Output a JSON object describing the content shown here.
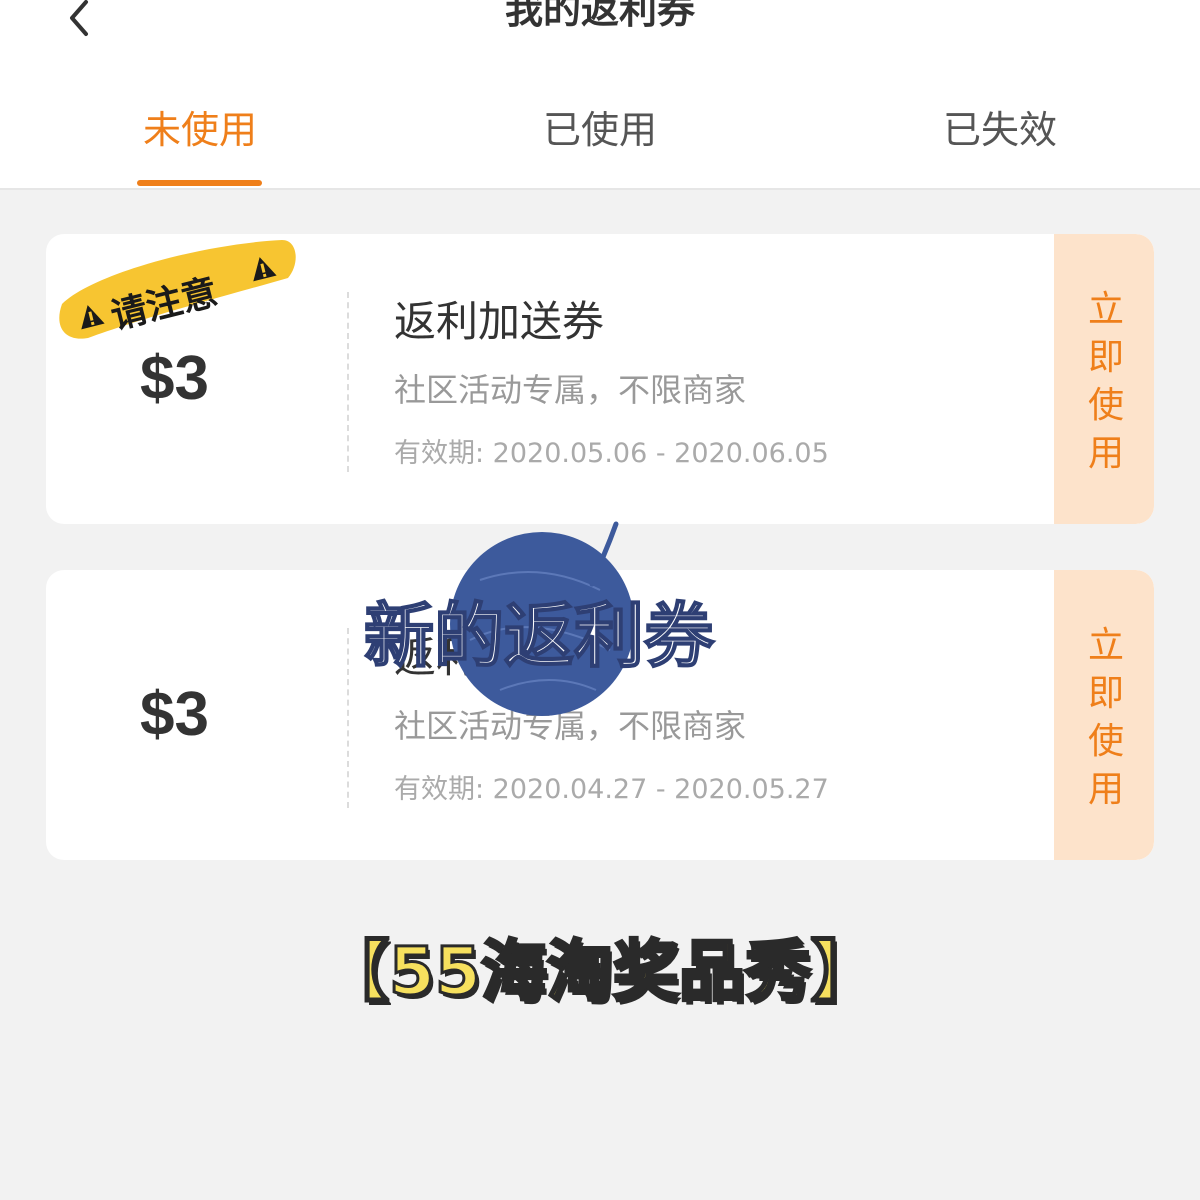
{
  "header": {
    "title": "我的返利券",
    "back_icon": "chevron-left-icon"
  },
  "tabs": [
    {
      "label": "未使用",
      "active": true
    },
    {
      "label": "已使用",
      "active": false
    },
    {
      "label": "已失效",
      "active": false
    }
  ],
  "coupons": [
    {
      "amount": "$3",
      "title": "返利加送券",
      "desc": "社区活动专属，不限商家",
      "validity": "有效期: 2020.05.06 - 2020.06.05",
      "button_label": "立即使用"
    },
    {
      "amount": "$3",
      "title": "返利加送券",
      "desc": "社区活动专属，不限商家",
      "validity": "有效期: 2020.04.27 - 2020.05.27",
      "button_label": "立即使用"
    }
  ],
  "sticker": {
    "text": "请注意"
  },
  "overlay": {
    "text": "新的返利券"
  },
  "promo": {
    "text": "【55海淘奖品秀】"
  },
  "colors": {
    "accent": "#ef7f1a",
    "button_bg": "#fde3cb",
    "sticker_bg": "#f7c531",
    "overlay_circle": "#3d5a9c",
    "page_bg": "#f2f2f2"
  }
}
